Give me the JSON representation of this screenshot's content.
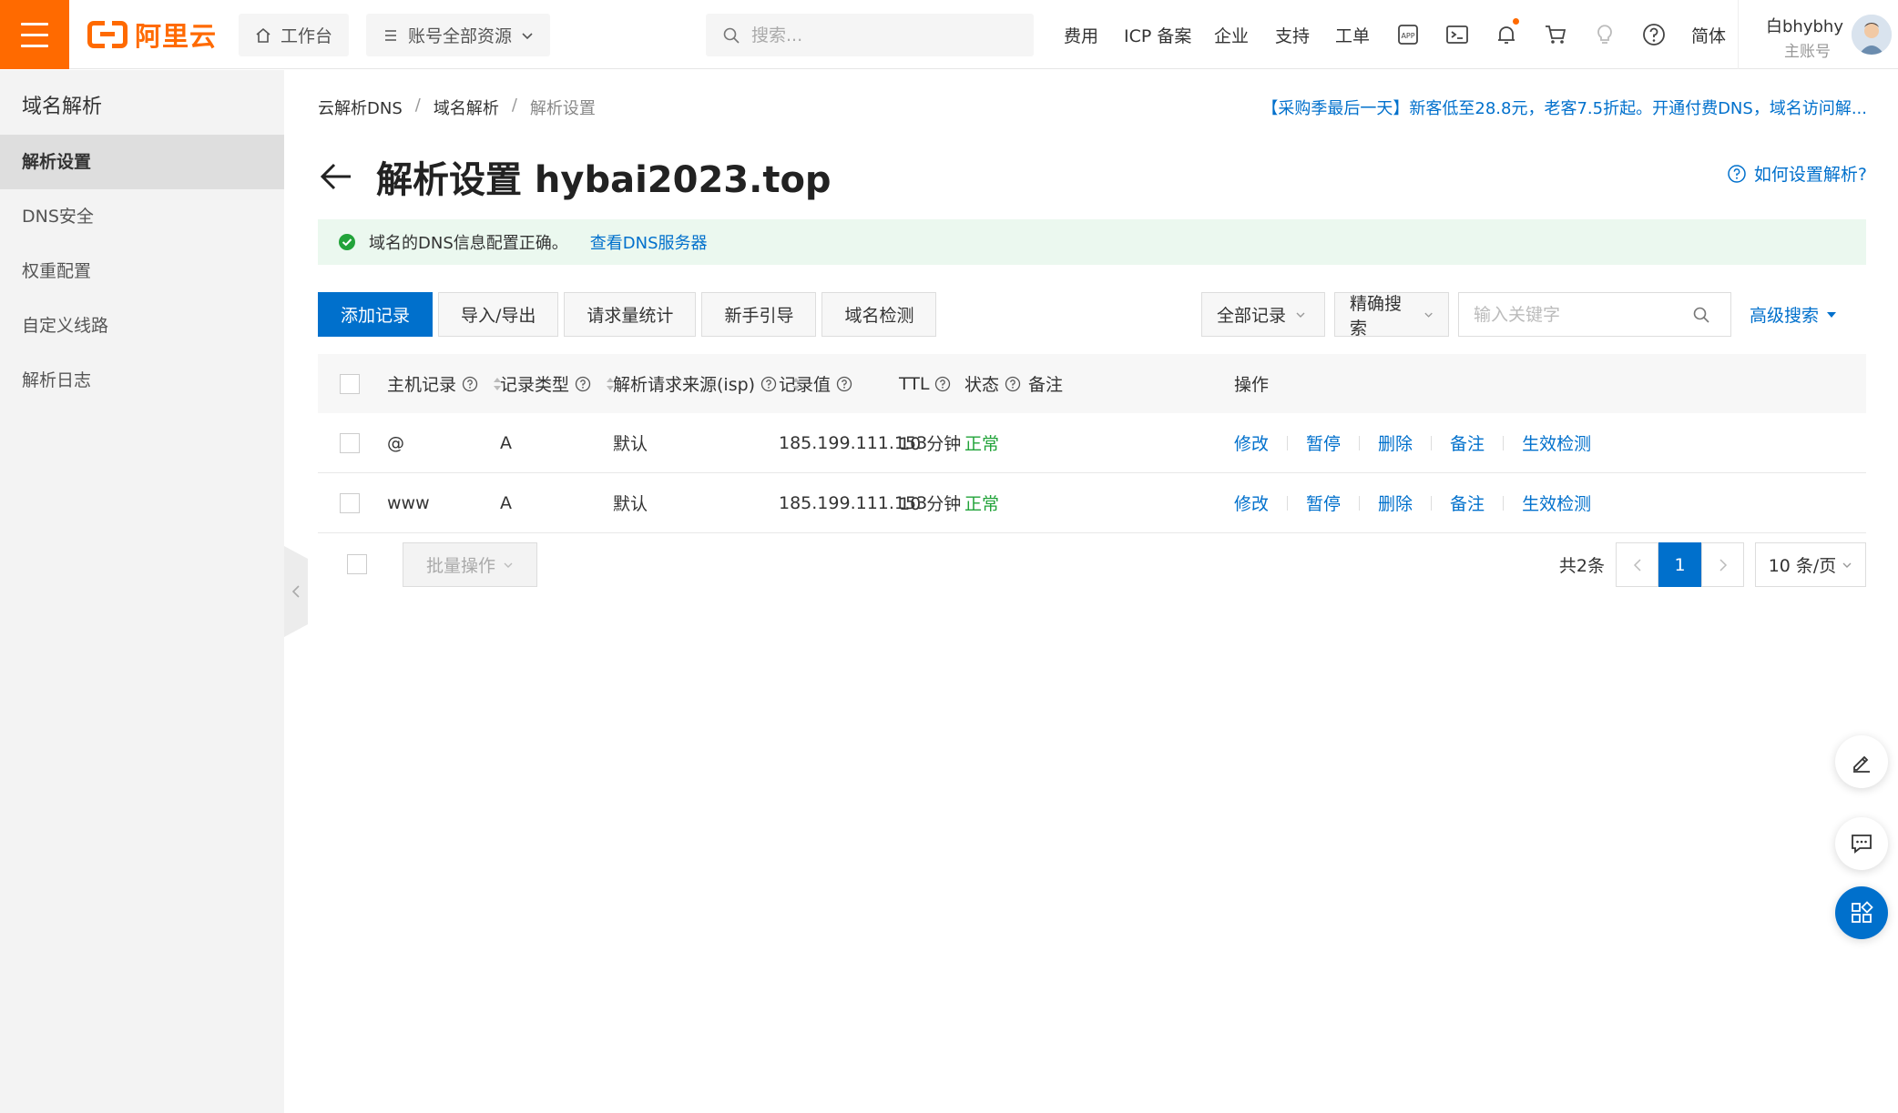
{
  "topbar": {
    "logo_text": "阿里云",
    "workbench": "工作台",
    "resources": "账号全部资源",
    "search_placeholder": "搜索...",
    "nav": [
      "费用",
      "ICP 备案",
      "企业",
      "支持",
      "工单"
    ],
    "lang": "简体",
    "user_name": "白bhybhy",
    "user_role": "主账号"
  },
  "sidebar": {
    "title": "域名解析",
    "items": [
      "解析设置",
      "DNS安全",
      "权重配置",
      "自定义线路",
      "解析日志"
    ]
  },
  "breadcrumb": [
    "云解析DNS",
    "域名解析",
    "解析设置"
  ],
  "promo": "【采购季最后一天】新客低至28.8元，老客7.5折起。开通付费DNS，域名访问解...",
  "page": {
    "title": "解析设置 hybai2023.top",
    "help": "如何设置解析?"
  },
  "alert": {
    "message": "域名的DNS信息配置正确。",
    "link": "查看DNS服务器"
  },
  "toolbar": [
    "添加记录",
    "导入/导出",
    "请求量统计",
    "新手引导",
    "域名检测"
  ],
  "filters": {
    "record_scope": "全部记录",
    "search_mode": "精确搜索",
    "keyword_placeholder": "输入关键字",
    "advanced": "高级搜索"
  },
  "table": {
    "headers": {
      "host": "主机记录",
      "type": "记录类型",
      "isp": "解析请求来源(isp)",
      "value": "记录值",
      "ttl": "TTL",
      "status": "状态",
      "remark": "备注",
      "ops": "操作"
    },
    "rows": [
      {
        "host": "@",
        "type": "A",
        "isp": "默认",
        "value": "185.199.111.153",
        "ttl": "10 分钟",
        "status": "正常",
        "remark": ""
      },
      {
        "host": "www",
        "type": "A",
        "isp": "默认",
        "value": "185.199.111.153",
        "ttl": "10 分钟",
        "status": "正常",
        "remark": ""
      }
    ],
    "ops": [
      "修改",
      "暂停",
      "删除",
      "备注",
      "生效检测"
    ]
  },
  "footer": {
    "batch": "批量操作",
    "total": "共2条",
    "current_page": "1",
    "page_size": "10 条/页"
  },
  "colors": {
    "brand": "#ff6a00",
    "primary": "#0070cc",
    "success": "#22a33a",
    "alert_bg": "#ebf8ef"
  }
}
